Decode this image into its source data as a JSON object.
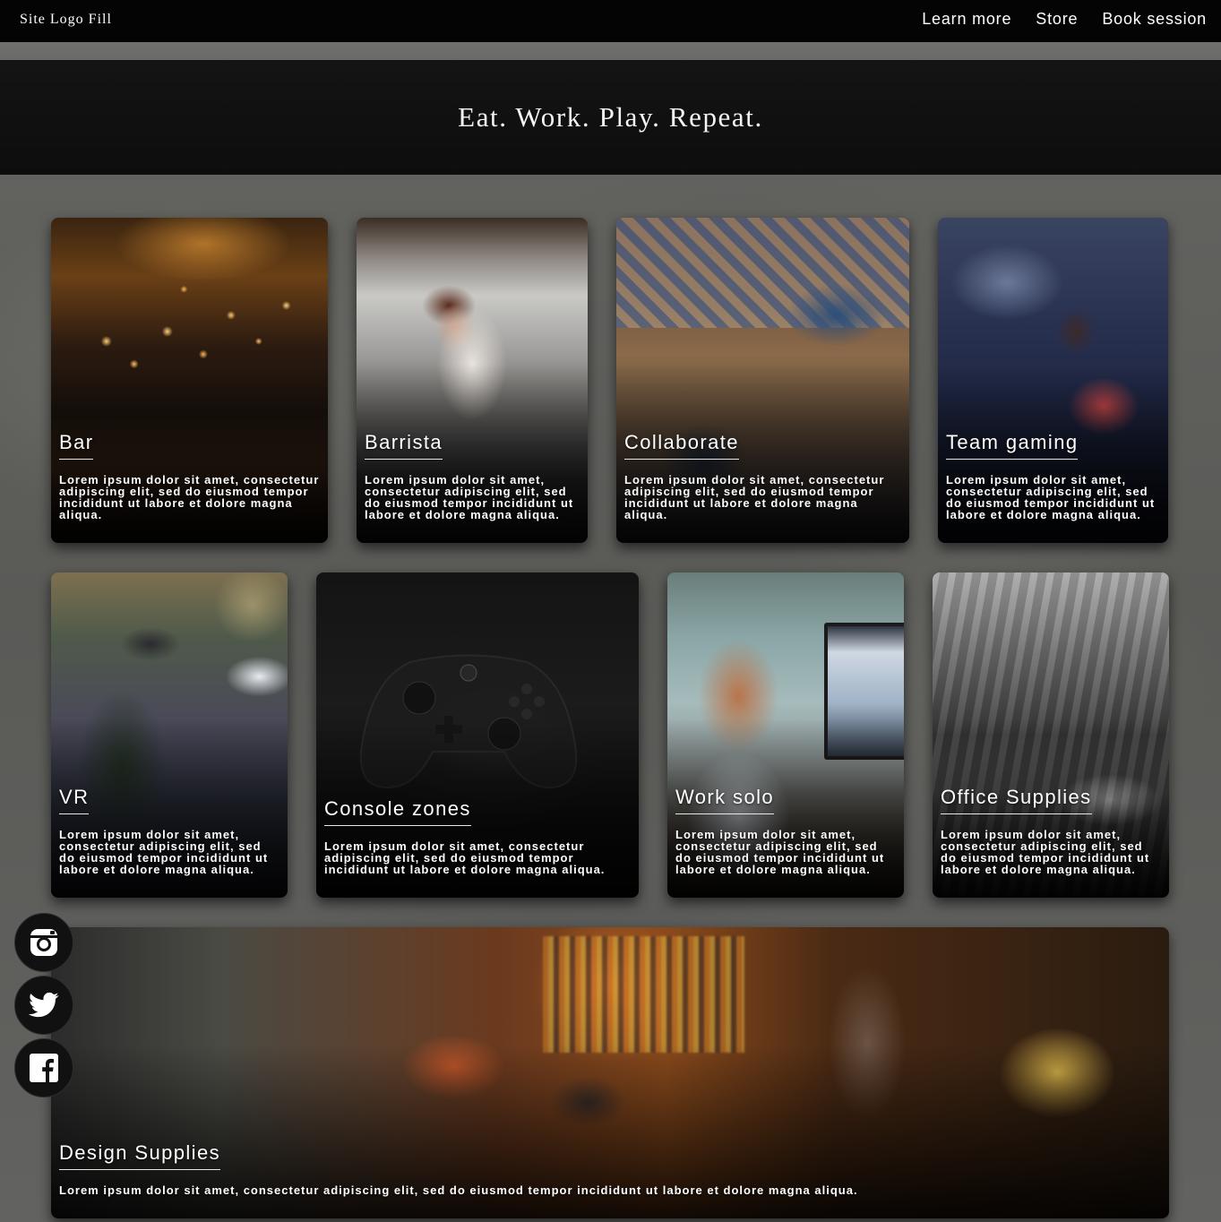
{
  "nav": {
    "logo": "Site Logo Fill",
    "links": [
      "Learn more",
      "Store",
      "Book session"
    ]
  },
  "hero": {
    "title": "Eat. Work. Play. Repeat."
  },
  "cards": [
    {
      "title": "Bar",
      "description": "Lorem ipsum dolor sit amet, consectetur adipiscing elit, sed do eiusmod tempor incididunt ut labore et dolore magna aliqua."
    },
    {
      "title": "Barrista",
      "description": "Lorem ipsum dolor sit amet, consectetur adipiscing elit, sed do eiusmod tempor incididunt ut labore et dolore magna aliqua."
    },
    {
      "title": "Collaborate",
      "description": "Lorem ipsum dolor sit amet, consectetur adipiscing elit, sed do eiusmod tempor incididunt ut labore et dolore magna aliqua."
    },
    {
      "title": "Team gaming",
      "description": "Lorem ipsum dolor sit amet, consectetur adipiscing elit, sed do eiusmod tempor incididunt ut labore et dolore magna aliqua."
    },
    {
      "title": "VR",
      "description": "Lorem ipsum dolor sit amet, consectetur adipiscing elit, sed do eiusmod tempor incididunt ut labore et dolore magna aliqua."
    },
    {
      "title": "Console zones",
      "description": "Lorem ipsum dolor sit amet, consectetur adipiscing elit, sed do eiusmod tempor incididunt ut labore et dolore magna aliqua."
    },
    {
      "title": "Work solo",
      "description": "Lorem ipsum dolor sit amet, consectetur adipiscing elit, sed do eiusmod tempor incididunt ut labore et dolore magna aliqua."
    },
    {
      "title": "Office Supplies",
      "description": "Lorem ipsum dolor sit amet, consectetur adipiscing elit, sed do eiusmod tempor incididunt ut labore et dolore magna aliqua."
    },
    {
      "title": "Design Supplies",
      "description": "Lorem ipsum dolor sit amet, consectetur adipiscing elit, sed do eiusmod tempor incididunt ut labore et dolore magna aliqua."
    }
  ],
  "social": [
    {
      "icon": "instagram-icon"
    },
    {
      "icon": "twitter-icon"
    },
    {
      "icon": "facebook-icon"
    }
  ],
  "colors": {
    "nav_bg": "#040404",
    "hero_bg": "#111111",
    "page_bg": "#5e5e5b",
    "text": "#ffffff"
  }
}
